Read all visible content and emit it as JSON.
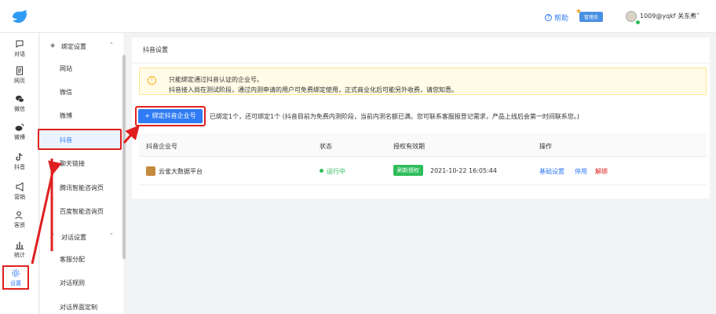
{
  "header": {
    "help": "帮助",
    "admin_badge": "管理员",
    "user": "1009@yqkf 关东煮"
  },
  "rail": {
    "items": [
      {
        "label": "对话",
        "icon": "chat-bubble-icon"
      },
      {
        "label": "网页",
        "icon": "document-icon"
      },
      {
        "label": "微信",
        "icon": "wechat-icon"
      },
      {
        "label": "微博",
        "icon": "weibo-icon"
      },
      {
        "label": "抖音",
        "icon": "tiktok-icon"
      },
      {
        "label": "营销",
        "icon": "megaphone-icon"
      },
      {
        "label": "客资",
        "icon": "users-icon"
      },
      {
        "label": "统计",
        "icon": "bar-chart-icon"
      },
      {
        "label": "设置",
        "icon": "gear-icon"
      }
    ]
  },
  "submenu": {
    "group1": "绑定设置",
    "group1_items": [
      "网站",
      "微信",
      "微博",
      "抖音",
      "聊天链接",
      "腾讯智能咨询页",
      "百度智能咨询页"
    ],
    "group2": "对话设置",
    "group2_items": [
      "客服分配",
      "对话规则",
      "对话界面定制"
    ]
  },
  "content": {
    "title": "抖音设置",
    "notice_line1": "只能绑定通过抖音认证的企业号。",
    "notice_line2": "抖音接入尚在测试阶段，通过内测申请的用户可免费绑定使用，正式商业化后可能另外收费，请您知悉。",
    "bind_button": "+ 绑定抖音企业号",
    "bound_text": "已绑定1个，还可绑定1个 (抖音目前为免费内测阶段，当前内测名额已满。您可联系客服报登记需求，产品上线后会第一时间联系您。)"
  },
  "table": {
    "columns": [
      "抖音企业号",
      "状态",
      "授权有效期",
      "操作"
    ],
    "rows": [
      {
        "account": "云雀大数据平台",
        "status": "运行中",
        "refresh": "刷新授权",
        "expiry": "2021-10-22 16:05:44",
        "ops": [
          "基础设置",
          "停用",
          "解绑"
        ]
      }
    ]
  },
  "colors": {
    "accent": "#2f7bf5",
    "highlight_box": "#e02020",
    "status_green": "#2ebd5a"
  }
}
